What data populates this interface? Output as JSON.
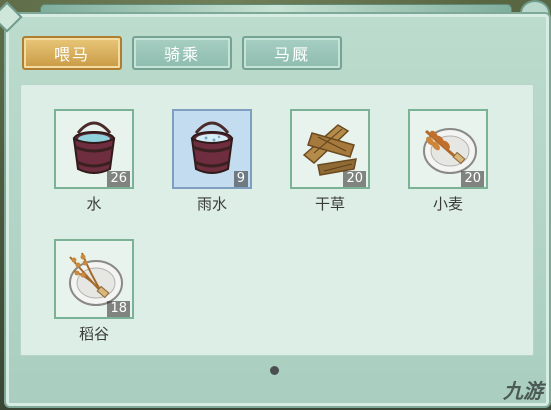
{
  "tabs": [
    {
      "label": "喂马",
      "active": true
    },
    {
      "label": "骑乘",
      "active": false
    },
    {
      "label": "马厩",
      "active": false
    }
  ],
  "items": [
    {
      "name": "水",
      "count": "26",
      "icon": "water-bucket-icon",
      "selected": false
    },
    {
      "name": "雨水",
      "count": "9",
      "icon": "rain-water-bucket-icon",
      "selected": true
    },
    {
      "name": "干草",
      "count": "20",
      "icon": "hay-bundle-icon",
      "selected": false
    },
    {
      "name": "小麦",
      "count": "20",
      "icon": "wheat-plate-icon",
      "selected": false
    },
    {
      "name": "稻谷",
      "count": "18",
      "icon": "rice-plate-icon",
      "selected": false
    }
  ],
  "pagination": {
    "current": 1,
    "total": 1
  },
  "colors": {
    "active_tab": "#c99a45",
    "inactive_tab": "#8dbcae",
    "slot_border": "#7bb296",
    "selected_slot": "#c4dcef"
  },
  "logo": {
    "text": "九游"
  }
}
